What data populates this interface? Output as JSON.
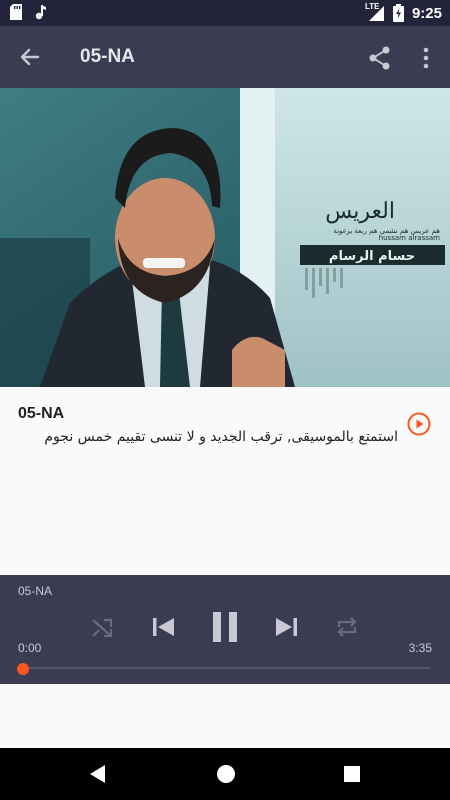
{
  "status_bar": {
    "time": "9:25",
    "network": "LTE",
    "icons": [
      "sd-card-icon",
      "music-note-icon",
      "signal-icon",
      "battery-charging-icon"
    ]
  },
  "toolbar": {
    "title": "05-NA",
    "icons": [
      "back-arrow-icon",
      "share-icon",
      "more-vert-icon"
    ]
  },
  "cover": {
    "logo_arabic": "العريس",
    "logo_tagline": "هم عريس هم نشمي هم ربعة يزغونة",
    "logo_latin": "hussam alrassam",
    "logo_arabic_2": "حسام الرسام"
  },
  "track": {
    "name": "05-NA",
    "description": "استمتع بالموسيقى, ترقب الجديد و لا تنسى تقييم خمس نجوم"
  },
  "player": {
    "title": "05-NA",
    "elapsed": "0:00",
    "duration": "3:35",
    "progress": 0.0,
    "accent": "#ff5722",
    "state": "playing"
  },
  "colors": {
    "toolbar_bg": "#3b3b52",
    "status_bg": "#23233a",
    "accent": "#ff5722"
  }
}
